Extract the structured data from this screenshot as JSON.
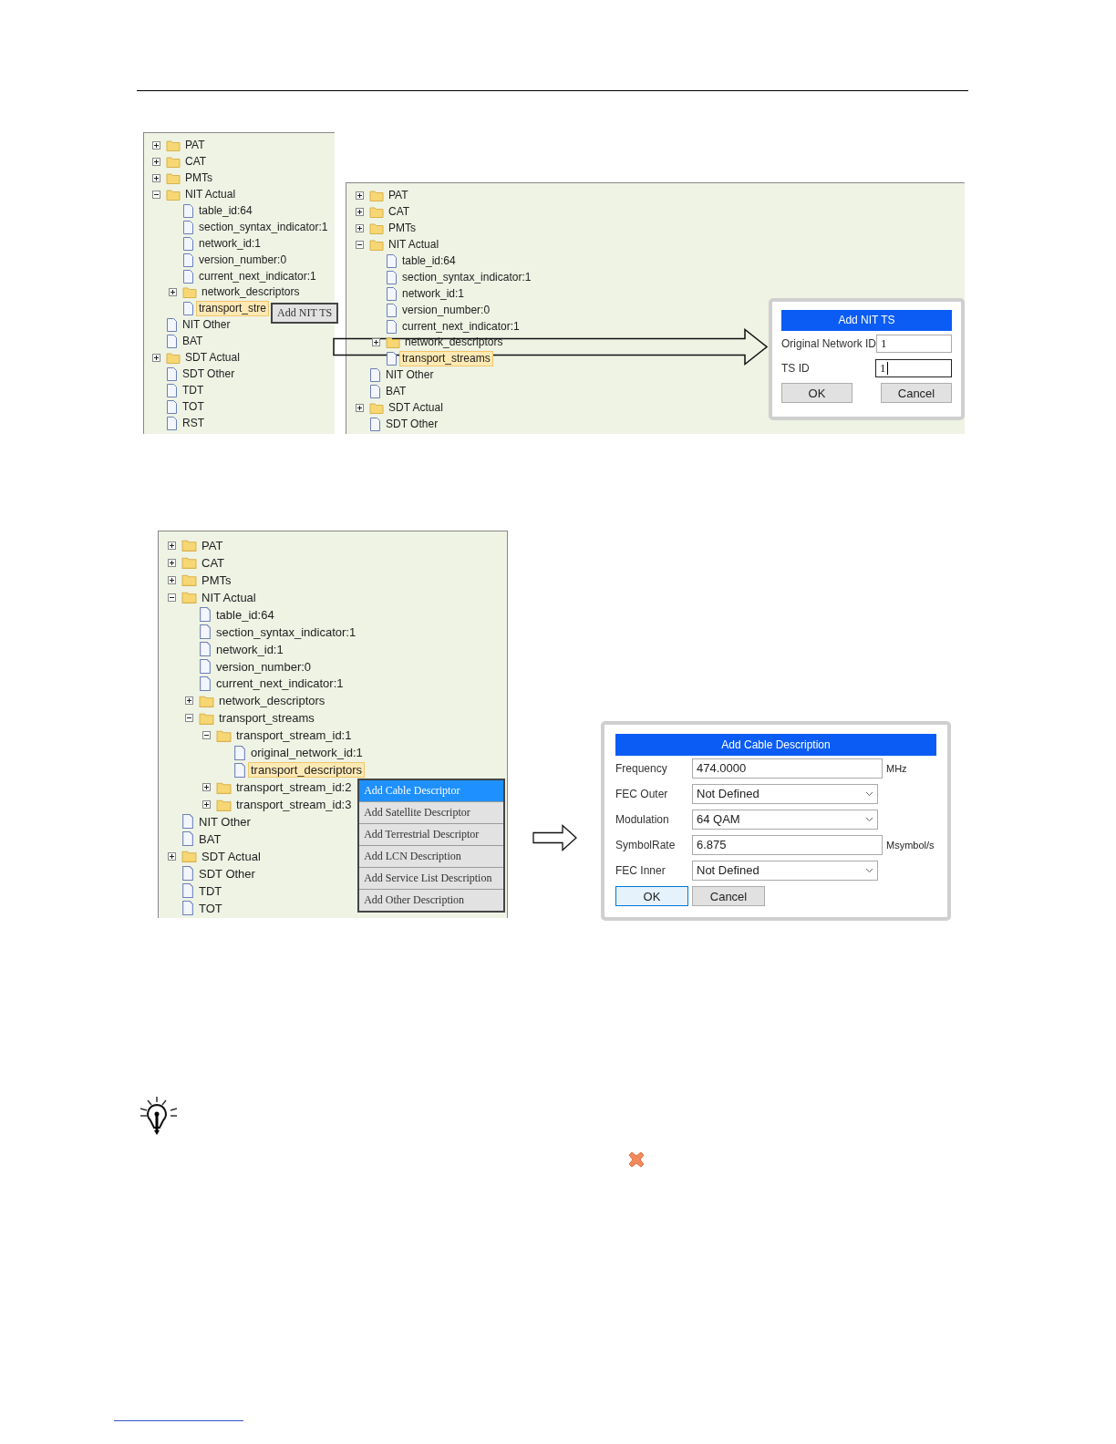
{
  "figure_1": {
    "left_tree": [
      {
        "label": "PAT",
        "kind": "folder",
        "expanded": false,
        "selected": false
      },
      {
        "label": "CAT",
        "kind": "folder",
        "expanded": false,
        "selected": false
      },
      {
        "label": "PMTs",
        "kind": "folder",
        "expanded": false,
        "selected": false
      },
      {
        "label": "NIT Actual",
        "kind": "folder",
        "expanded": true,
        "selected": false,
        "children": [
          {
            "label": "table_id:64",
            "kind": "file",
            "selected": false
          },
          {
            "label": "section_syntax_indicator:1",
            "kind": "file",
            "selected": false
          },
          {
            "label": "network_id:1",
            "kind": "file",
            "selected": false
          },
          {
            "label": "version_number:0",
            "kind": "file",
            "selected": false
          },
          {
            "label": "current_next_indicator:1",
            "kind": "file",
            "selected": false
          },
          {
            "label": "network_descriptors",
            "kind": "folder",
            "expanded": false,
            "selected": false
          },
          {
            "label": "transport_stre",
            "kind": "file",
            "selected": true,
            "context_menu": [
              {
                "label": "Add NIT TS",
                "selected": false
              }
            ]
          }
        ]
      },
      {
        "label": "NIT Other",
        "kind": "file",
        "selected": false
      },
      {
        "label": "BAT",
        "kind": "file",
        "selected": false
      },
      {
        "label": "SDT Actual",
        "kind": "folder",
        "expanded": false,
        "selected": false
      },
      {
        "label": "SDT Other",
        "kind": "file",
        "selected": false
      },
      {
        "label": "TDT",
        "kind": "file",
        "selected": false
      },
      {
        "label": "TOT",
        "kind": "file",
        "selected": false
      },
      {
        "label": "RST",
        "kind": "file",
        "selected": false
      }
    ],
    "right_tree": [
      {
        "label": "PAT",
        "kind": "folder",
        "expanded": false,
        "selected": false
      },
      {
        "label": "CAT",
        "kind": "folder",
        "expanded": false,
        "selected": false
      },
      {
        "label": "PMTs",
        "kind": "folder",
        "expanded": false,
        "selected": false
      },
      {
        "label": "NIT Actual",
        "kind": "folder",
        "expanded": true,
        "selected": false,
        "children": [
          {
            "label": "table_id:64",
            "kind": "file",
            "selected": false
          },
          {
            "label": "section_syntax_indicator:1",
            "kind": "file",
            "selected": false
          },
          {
            "label": "network_id:1",
            "kind": "file",
            "selected": false
          },
          {
            "label": "version_number:0",
            "kind": "file",
            "selected": false
          },
          {
            "label": "current_next_indicator:1",
            "kind": "file",
            "selected": false
          },
          {
            "label": "network_descriptors",
            "kind": "folder",
            "expanded": false,
            "selected": false
          },
          {
            "label": "transport_streams",
            "kind": "file",
            "selected": true
          }
        ]
      },
      {
        "label": "NIT Other",
        "kind": "file",
        "selected": false
      },
      {
        "label": "BAT",
        "kind": "file",
        "selected": false
      },
      {
        "label": "SDT Actual",
        "kind": "folder",
        "expanded": false,
        "selected": false
      },
      {
        "label": "SDT Other",
        "kind": "file",
        "selected": false
      }
    ],
    "dialog": {
      "title": "Add NIT TS",
      "fields": [
        {
          "label": "Original Network ID",
          "value": "1",
          "focused": false
        },
        {
          "label": "TS ID",
          "value": "1",
          "focused": true
        }
      ],
      "buttons": [
        {
          "label": "OK",
          "default": false
        },
        {
          "label": "Cancel",
          "default": false
        }
      ]
    }
  },
  "figure_2": {
    "tree": [
      {
        "label": "PAT",
        "kind": "folder",
        "expanded": false,
        "selected": false
      },
      {
        "label": "CAT",
        "kind": "folder",
        "expanded": false,
        "selected": false
      },
      {
        "label": "PMTs",
        "kind": "folder",
        "expanded": false,
        "selected": false
      },
      {
        "label": "NIT Actual",
        "kind": "folder",
        "expanded": true,
        "selected": false,
        "children": [
          {
            "label": "table_id:64",
            "kind": "file",
            "selected": false
          },
          {
            "label": "section_syntax_indicator:1",
            "kind": "file",
            "selected": false
          },
          {
            "label": "network_id:1",
            "kind": "file",
            "selected": false
          },
          {
            "label": "version_number:0",
            "kind": "file",
            "selected": false
          },
          {
            "label": "current_next_indicator:1",
            "kind": "file",
            "selected": false
          },
          {
            "label": "network_descriptors",
            "kind": "folder",
            "expanded": false,
            "selected": false
          },
          {
            "label": "transport_streams",
            "kind": "folder",
            "expanded": true,
            "selected": false,
            "children": [
              {
                "label": "transport_stream_id:1",
                "kind": "folder",
                "expanded": true,
                "selected": false,
                "children": [
                  {
                    "label": "original_network_id:1",
                    "kind": "file",
                    "selected": false
                  },
                  {
                    "label": "transport_descriptors",
                    "kind": "file",
                    "selected": true,
                    "context_menu": [
                      {
                        "label": "Add Cable Descriptor",
                        "selected": true
                      },
                      {
                        "label": "Add Satellite Descriptor",
                        "selected": false
                      },
                      {
                        "label": "Add Terrestrial Descriptor",
                        "selected": false
                      },
                      {
                        "label": "Add LCN Description",
                        "selected": false
                      },
                      {
                        "label": "Add Service List Description",
                        "selected": false
                      },
                      {
                        "label": "Add Other Description",
                        "selected": false
                      }
                    ]
                  }
                ]
              },
              {
                "label": "transport_stream_id:2",
                "kind": "folder",
                "expanded": false,
                "selected": false
              },
              {
                "label": "transport_stream_id:3",
                "kind": "folder",
                "expanded": false,
                "selected": false
              }
            ]
          }
        ]
      },
      {
        "label": "NIT Other",
        "kind": "file",
        "selected": false
      },
      {
        "label": "BAT",
        "kind": "file",
        "selected": false
      },
      {
        "label": "SDT Actual",
        "kind": "folder",
        "expanded": false,
        "selected": false
      },
      {
        "label": "SDT Other",
        "kind": "file",
        "selected": false
      },
      {
        "label": "TDT",
        "kind": "file",
        "selected": false
      },
      {
        "label": "TOT",
        "kind": "file",
        "selected": false
      }
    ],
    "dialog": {
      "title": "Add Cable Description",
      "fields": [
        {
          "label": "Frequency",
          "kind": "text",
          "value": "474.0000",
          "unit": "MHz"
        },
        {
          "label": "FEC Outer",
          "kind": "select",
          "value": "Not Defined"
        },
        {
          "label": "Modulation",
          "kind": "select",
          "value": "64 QAM"
        },
        {
          "label": "SymbolRate",
          "kind": "text",
          "value": "6.875",
          "unit": "Msymbol/s"
        },
        {
          "label": "FEC Inner",
          "kind": "select",
          "value": "Not Defined"
        }
      ],
      "buttons": [
        {
          "label": "OK",
          "default": true
        },
        {
          "label": "Cancel",
          "default": false
        }
      ]
    }
  }
}
